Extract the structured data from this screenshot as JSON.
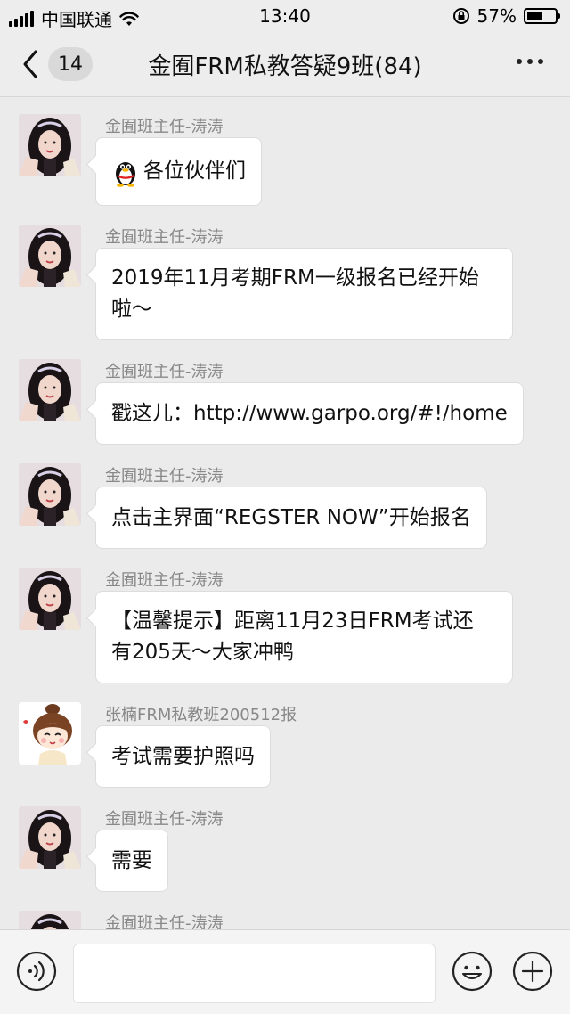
{
  "status_bar": {
    "carrier": "中国联通",
    "time": "13:40",
    "battery_percent": "57%",
    "battery_level": 0.57
  },
  "nav": {
    "unread_count": "14",
    "title": "金囿FRM私教答疑9班(84)"
  },
  "messages": [
    {
      "sender": "金囿班主任-涛涛",
      "text": "各位伙伴们",
      "has_emoji": true,
      "avatar": "teacher"
    },
    {
      "sender": "金囿班主任-涛涛",
      "text": "2019年11月考期FRM一级报名已经开始\n啦～",
      "avatar": "teacher"
    },
    {
      "sender": "金囿班主任-涛涛",
      "text": "戳这儿：http://www.garpo.org/#!/home",
      "avatar": "teacher"
    },
    {
      "sender": "金囿班主任-涛涛",
      "text": "点击主界面“REGSTER NOW”开始报名",
      "avatar": "teacher"
    },
    {
      "sender": "金囿班主任-涛涛",
      "text": "【温馨提示】距离11月23日FRM考试还\n有205天～大家冲鸭",
      "avatar": "teacher"
    },
    {
      "sender": "张楠FRM私教班200512报",
      "text": "考试需要护照吗",
      "avatar": "cartoon"
    },
    {
      "sender": "金囿班主任-涛涛",
      "text": "需要",
      "avatar": "teacher"
    },
    {
      "sender": "金囿班主任-涛涛",
      "text": "",
      "avatar": "teacher"
    }
  ],
  "input": {
    "value": "",
    "placeholder": ""
  },
  "icons": {
    "back": "chevron-left-icon",
    "more": "more-dots-icon",
    "voice": "voice-icon",
    "emoji": "emoji-icon",
    "plus": "plus-icon",
    "qq_emoji": "qq-penguin-icon"
  },
  "colors": {
    "background": "#ebebeb",
    "bubble": "#ffffff",
    "sender_name": "#888888"
  }
}
